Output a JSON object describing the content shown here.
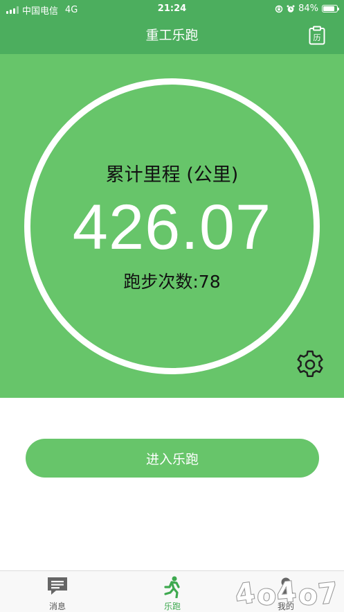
{
  "status_bar": {
    "carrier": "中国电信",
    "network": "4G",
    "time": "21:24",
    "battery": "84%",
    "battery_level": 0.84
  },
  "nav": {
    "title": "重工乐跑",
    "history_icon_text": "历"
  },
  "stats": {
    "distance_label": "累计里程 (公里)",
    "distance_value": "426.07",
    "run_count": "跑步次数:78"
  },
  "enter_button": "进入乐跑",
  "tabs": [
    {
      "label": "消息",
      "icon": "message-icon",
      "active": false
    },
    {
      "label": "乐跑",
      "icon": "runner-icon",
      "active": true
    },
    {
      "label": "我的",
      "icon": "profile-icon",
      "active": false
    }
  ],
  "colors": {
    "nav_green": "#4cae5e",
    "hero_green": "#67c56a",
    "active_tab": "#3ea94f"
  }
}
